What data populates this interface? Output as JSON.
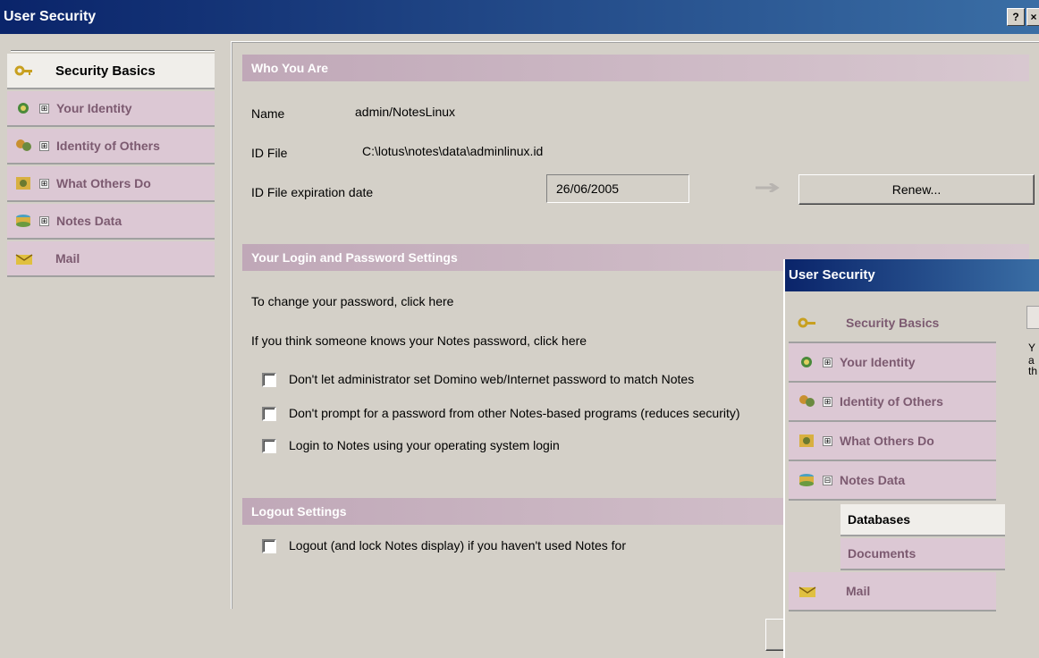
{
  "window": {
    "title": "User Security",
    "help_glyph": "?",
    "close_glyph": "×"
  },
  "sidebar": {
    "items": [
      {
        "label": "Security Basics",
        "icon": "key-icon",
        "expandable": false
      },
      {
        "label": "Your Identity",
        "icon": "identity-icon",
        "expandable": true,
        "expander": "⊞"
      },
      {
        "label": "Identity of Others",
        "icon": "people-icon",
        "expandable": true,
        "expander": "⊞"
      },
      {
        "label": "What Others Do",
        "icon": "gears-icon",
        "expandable": true,
        "expander": "⊞"
      },
      {
        "label": "Notes Data",
        "icon": "database-icon",
        "expandable": true,
        "expander": "⊞"
      },
      {
        "label": "Mail",
        "icon": "mail-icon",
        "expandable": false
      }
    ]
  },
  "who_you_are": {
    "header": "Who You Are",
    "name_label": "Name",
    "name_value": "admin/NotesLinux",
    "idfile_label": "ID File",
    "idfile_value": "C:\\lotus\\notes\\data\\adminlinux.id",
    "expiration_label": "ID File expiration date",
    "expiration_value": "26/06/2005",
    "renew_label": "Renew..."
  },
  "login_password": {
    "header": "Your Login and Password Settings",
    "change_password_text": "To change your password, click here",
    "someone_knows_text": "If you think someone knows your Notes password, click here",
    "checkboxes": [
      {
        "label": "Don't let administrator set Domino web/Internet password to match Notes",
        "checked": false
      },
      {
        "label": "Don't prompt for a password from other Notes-based programs (reduces security)",
        "checked": false
      },
      {
        "label": "Login to Notes using your operating system login",
        "checked": false
      }
    ]
  },
  "logout": {
    "header": "Logout Settings",
    "checkbox_label": "Logout (and lock Notes display) if you haven't used Notes for",
    "checked": false
  },
  "overlay": {
    "title": "User Security",
    "items": [
      {
        "label": "Security Basics",
        "icon": "key-icon"
      },
      {
        "label": "Your Identity",
        "icon": "identity-icon",
        "expander": "⊞"
      },
      {
        "label": "Identity of Others",
        "icon": "people-icon",
        "expander": "⊞"
      },
      {
        "label": "What Others Do",
        "icon": "gears-icon",
        "expander": "⊞"
      },
      {
        "label": "Notes Data",
        "icon": "database-icon",
        "expander": "⊟"
      }
    ],
    "subitems": [
      "Databases",
      "Documents"
    ],
    "mail_label": "Mail",
    "peek_text": [
      "Y",
      "a",
      "th"
    ]
  }
}
